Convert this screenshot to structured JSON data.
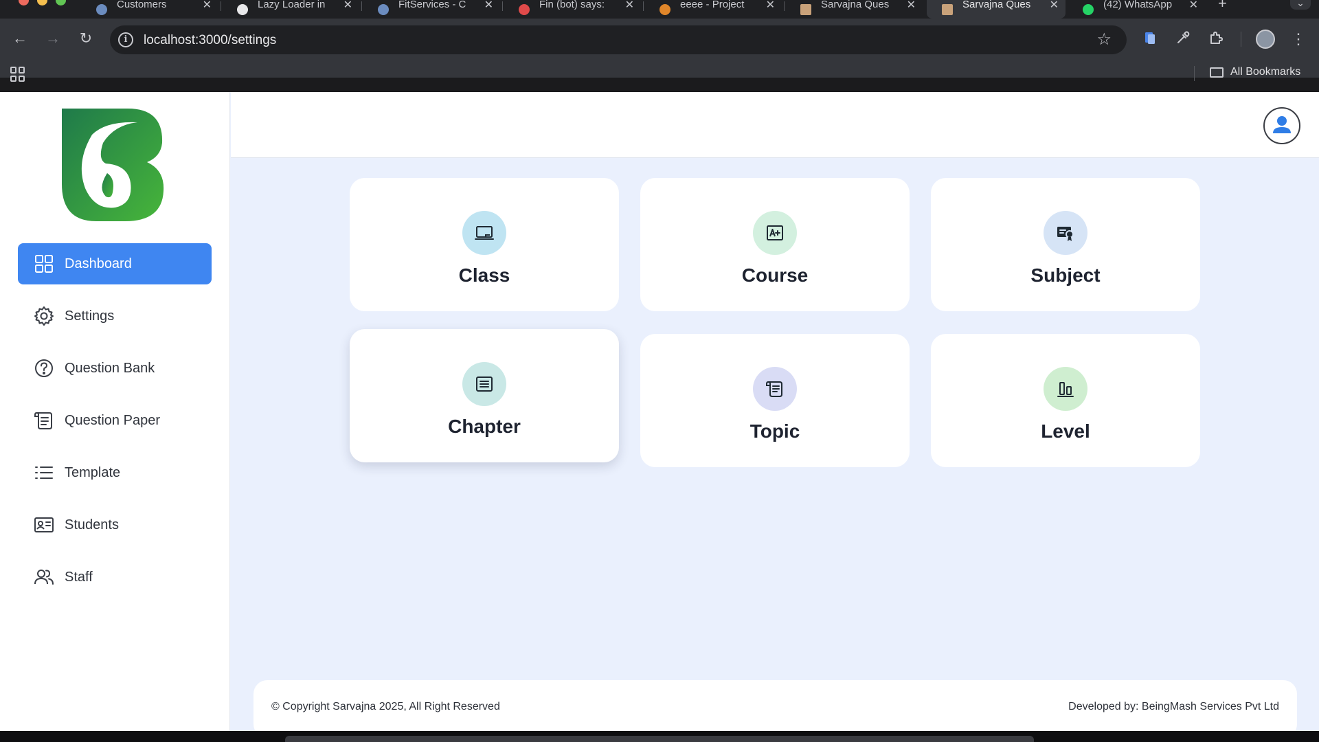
{
  "browser": {
    "tabs": [
      {
        "title": "Customers",
        "favicon_color": "#6b8cbf"
      },
      {
        "title": "Lazy Loader in",
        "favicon_color": "#e8e8ea"
      },
      {
        "title": "FitServices - C",
        "favicon_color": "#6b8cbf"
      },
      {
        "title": "Fin (bot) says:",
        "favicon_color": "#e04a4a"
      },
      {
        "title": "eeee - Project",
        "favicon_color": "#e0862a"
      },
      {
        "title": "Sarvajna Ques",
        "favicon_color": "#c9a27a"
      },
      {
        "title": "Sarvajna Ques",
        "favicon_color": "#c9a27a"
      },
      {
        "title": "(42) WhatsApp",
        "favicon_color": "#25d366"
      }
    ],
    "url": "localhost:3000/settings",
    "bookmarks_label": "All Bookmarks"
  },
  "sidebar": {
    "items": [
      {
        "label": "Dashboard",
        "icon": "grid-icon",
        "active": true
      },
      {
        "label": "Settings",
        "icon": "gear-icon"
      },
      {
        "label": "Question Bank",
        "icon": "help-circle-icon"
      },
      {
        "label": "Question Paper",
        "icon": "scroll-icon"
      },
      {
        "label": "Template",
        "icon": "list-icon"
      },
      {
        "label": "Students",
        "icon": "id-card-icon"
      },
      {
        "label": "Staff",
        "icon": "users-icon"
      }
    ]
  },
  "cards": [
    {
      "label": "Class",
      "icon": "monitor-icon",
      "icon_bg": "#bfe4f2"
    },
    {
      "label": "Course",
      "icon": "grade-a-plus-icon",
      "icon_bg": "#d3f0df"
    },
    {
      "label": "Subject",
      "icon": "certificate-icon",
      "icon_bg": "#d6e4f6"
    },
    {
      "label": "Chapter",
      "icon": "notes-icon",
      "icon_bg": "#c9e8e6"
    },
    {
      "label": "Topic",
      "icon": "scroll-icon",
      "icon_bg": "#d9dcf5"
    },
    {
      "label": "Level",
      "icon": "bar-level-icon",
      "icon_bg": "#cfeed0"
    }
  ],
  "footer": {
    "copyright": "© Copyright Sarvajna 2025, All Right Reserved",
    "developer": "Developed by: BeingMash Services Pvt Ltd"
  },
  "colors": {
    "accent": "#3f86f1",
    "background": "#eaf0fd",
    "logo_green": "#2e9d4a"
  }
}
